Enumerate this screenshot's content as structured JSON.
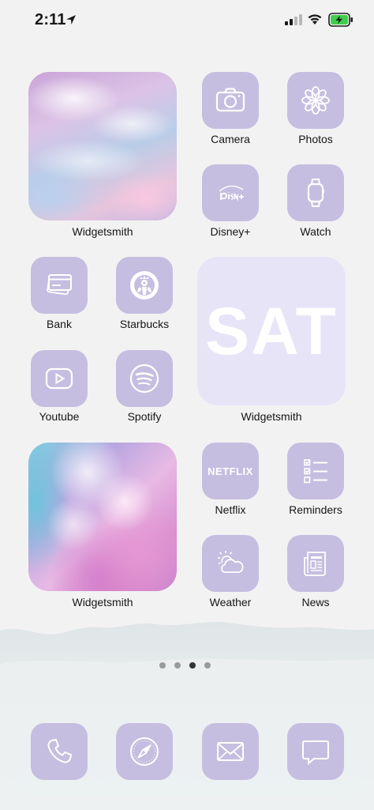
{
  "status_bar": {
    "time": "2:11",
    "icons": [
      "location-arrow-icon",
      "cellular-signal-icon",
      "wifi-icon",
      "battery-charging-icon"
    ],
    "battery_color": "#3ecf4a"
  },
  "widgets": [
    {
      "id": "widget1",
      "label": "Widgetsmith",
      "kind": "pastel-sky-photo"
    },
    {
      "id": "widget2",
      "label": "Widgetsmith",
      "day": "SAT"
    },
    {
      "id": "widget3",
      "label": "Widgetsmith",
      "kind": "pink-crystal-photo"
    }
  ],
  "apps": {
    "camera": {
      "label": "Camera",
      "icon": "camera-icon"
    },
    "photos": {
      "label": "Photos",
      "icon": "flower-icon"
    },
    "disney": {
      "label": "Disney+",
      "icon": "disney-plus-logo-icon"
    },
    "watch": {
      "label": "Watch",
      "icon": "watch-icon"
    },
    "bank": {
      "label": "Bank",
      "icon": "card-icon"
    },
    "starbucks": {
      "label": "Starbucks",
      "icon": "starbucks-siren-icon"
    },
    "youtube": {
      "label": "Youtube",
      "icon": "play-button-icon"
    },
    "spotify": {
      "label": "Spotify",
      "icon": "spotify-icon"
    },
    "netflix": {
      "label": "Netflix",
      "icon": "netflix-wordmark-icon",
      "wordmark": "NETFLIX"
    },
    "reminders": {
      "label": "Reminders",
      "icon": "checklist-icon"
    },
    "weather": {
      "label": "Weather",
      "icon": "sun-cloud-icon"
    },
    "news": {
      "label": "News",
      "icon": "newspaper-icon"
    }
  },
  "page_indicator": {
    "count": 4,
    "active": 3
  },
  "dock": [
    {
      "name": "phone",
      "icon": "phone-icon"
    },
    {
      "name": "safari",
      "icon": "compass-icon"
    },
    {
      "name": "mail",
      "icon": "mail-icon"
    },
    {
      "name": "messages",
      "icon": "speech-bubble-icon"
    }
  ],
  "colors": {
    "icon_tile": "#c6bee0",
    "widget_sat_bg": "#e8e4f8",
    "background": "#f3f2f3"
  }
}
